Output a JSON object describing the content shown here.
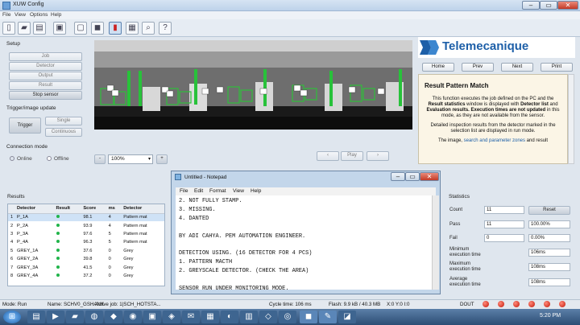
{
  "window": {
    "title": "XUW Config"
  },
  "menu": [
    "File",
    "View",
    "Options",
    "Help"
  ],
  "setup": {
    "label": "Setup",
    "buttons": [
      "Job",
      "Detector",
      "Output",
      "Result",
      "Stop sensor"
    ]
  },
  "trigger": {
    "label": "Trigger/image update",
    "trigger_button": "Trigger",
    "single_button": "Single",
    "continuous_button": "Continuous"
  },
  "connection": {
    "label": "Connection mode",
    "online": "Online",
    "offline": "Offline"
  },
  "camera": {
    "zoom_minus": "-",
    "zoom_value": "100%",
    "zoom_plus": "+",
    "play_label": "Play",
    "markers": [
      "1",
      "2",
      "3",
      "4",
      "5",
      "6",
      "8",
      "9",
      "10",
      "11",
      "12",
      "13",
      "14",
      "15",
      "16",
      "17",
      "18"
    ]
  },
  "brand": {
    "name": "Telemecanique"
  },
  "nav": [
    "Home",
    "Prev",
    "Next",
    "Print"
  ],
  "help": {
    "title": "Result Pattern Match",
    "para1_a": "This function executes the job defined on the PC and the ",
    "para1_b": "Result statistics",
    "para1_c": " window is displayed with ",
    "para1_d": "Detector list",
    "para1_e": " and ",
    "para1_f": "Evaluation results.",
    "para1_g": " ",
    "para1_h": "Execution times are not updated",
    "para1_i": " in this mode, as they are not available from the sensor.",
    "para2": "Detailed inspection results from the detector marked in the selection list are displayed in run mode.",
    "para3_a": "The image, ",
    "para3_b": "search and parameter zones",
    "para3_c": " and result"
  },
  "results": {
    "label": "Results",
    "columns": [
      "Detector",
      "Result",
      "Score",
      "ms",
      "Detector"
    ],
    "rows": [
      {
        "detector": "P_1A",
        "score": "98.1",
        "ms": "4",
        "type": "Pattern mat"
      },
      {
        "detector": "P_2A",
        "score": "93.9",
        "ms": "4",
        "type": "Pattern mat"
      },
      {
        "detector": "P_3A",
        "score": "97.6",
        "ms": "5",
        "type": "Pattern mat"
      },
      {
        "detector": "P_4A",
        "score": "96.3",
        "ms": "5",
        "type": "Pattern mat"
      },
      {
        "detector": "GREY_1A",
        "score": "37.6",
        "ms": "0",
        "type": "Grey"
      },
      {
        "detector": "GREY_2A",
        "score": "39.8",
        "ms": "0",
        "type": "Grey"
      },
      {
        "detector": "GREY_3A",
        "score": "41.5",
        "ms": "0",
        "type": "Grey"
      },
      {
        "detector": "GREY_4A",
        "score": "37.2",
        "ms": "0",
        "type": "Grey"
      }
    ]
  },
  "notepad": {
    "title": "Untitled - Notepad",
    "menu": [
      "File",
      "Edit",
      "Format",
      "View",
      "Help"
    ],
    "text": "2. NOT FULLY STAMP.\n3. MISSING.\n4. DANTED\n\nBY ADI CAHYA. PEM AUTOMATION ENGINEER.\n\nDETECTION USING. (16 DETECTOR FOR 4 PCS)\n1. PATTERN MACTH\n2. GREYSCALE DETECTOR. (CHECK THE AREA)\n\nSENSOR RUN UNDER MONITORING MODE.\n\nTRIGGER BY PLC.\n\nYHANK YOU!!!!"
  },
  "statistics": {
    "label": "Statistics",
    "count_label": "Count",
    "count_value": "11",
    "reset_button": "Reset",
    "pass_label": "Pass",
    "pass_value": "11",
    "pass_pct": "100.00%",
    "fail_label": "Fail",
    "fail_value": "0",
    "fail_pct": "0.00%",
    "min_label": "Minimum execution time",
    "min_value": "106ms",
    "max_label": "Maximum execution time",
    "max_value": "108ms",
    "avg_label": "Average execution time",
    "avg_value": "108ms"
  },
  "status": {
    "mode": "Mode: Run",
    "name": "Name: SCHV0_GSHANK",
    "job": "Active job: 1|SCH_HOTSTA...",
    "cycle": "Cycle time: 106 ms",
    "flash": "Flash: 9.9 kB / 40.3 MB",
    "coords": "X:0 Y:0 I:0",
    "dout": "DOUT"
  },
  "taskbar": {
    "time": "5:20 PM"
  },
  "colors": {
    "accent": "#1d5fa8",
    "pass": "#21b44b",
    "led": "#d81e0d"
  }
}
